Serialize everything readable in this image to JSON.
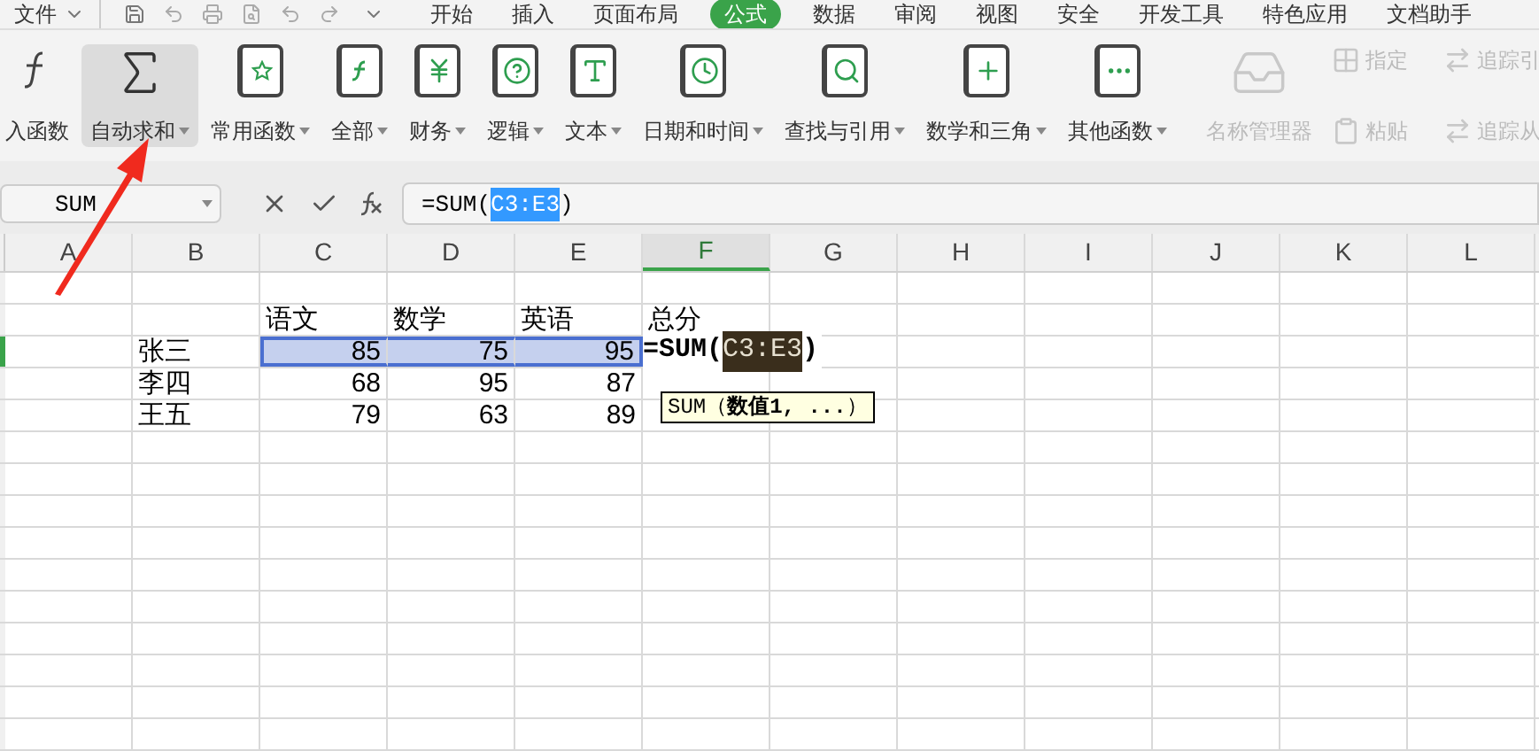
{
  "menu_tabs": [
    {
      "label": "文件",
      "selected": false
    },
    {
      "label": "开始",
      "selected": false
    },
    {
      "label": "插入",
      "selected": false
    },
    {
      "label": "页面布局",
      "selected": false
    },
    {
      "label": "公式",
      "selected": true
    },
    {
      "label": "数据",
      "selected": false
    },
    {
      "label": "审阅",
      "selected": false
    },
    {
      "label": "视图",
      "selected": false
    },
    {
      "label": "安全",
      "selected": false
    },
    {
      "label": "开发工具",
      "selected": false
    },
    {
      "label": "特色应用",
      "selected": false
    },
    {
      "label": "文档助手",
      "selected": false
    }
  ],
  "ribbon": [
    {
      "kind": "large",
      "label": "入函数",
      "dropdown": false,
      "selected": false,
      "disabled": false
    },
    {
      "kind": "large",
      "label": "自动求和",
      "dropdown": true,
      "selected": true,
      "disabled": false
    },
    {
      "kind": "large",
      "label": "常用函数",
      "dropdown": true,
      "selected": false,
      "disabled": false
    },
    {
      "kind": "large",
      "label": "全部",
      "dropdown": true,
      "selected": false,
      "disabled": false
    },
    {
      "kind": "large",
      "label": "财务",
      "dropdown": true,
      "selected": false,
      "disabled": false
    },
    {
      "kind": "large",
      "label": "逻辑",
      "dropdown": true,
      "selected": false,
      "disabled": false
    },
    {
      "kind": "large",
      "label": "文本",
      "dropdown": true,
      "selected": false,
      "disabled": false
    },
    {
      "kind": "large",
      "label": "日期和时间",
      "dropdown": true,
      "selected": false,
      "disabled": false
    },
    {
      "kind": "large",
      "label": "查找与引用",
      "dropdown": true,
      "selected": false,
      "disabled": false
    },
    {
      "kind": "large",
      "label": "数学和三角",
      "dropdown": true,
      "selected": false,
      "disabled": false
    },
    {
      "kind": "large",
      "label": "其他函数",
      "dropdown": true,
      "selected": false,
      "disabled": false
    },
    {
      "kind": "divider"
    },
    {
      "kind": "large",
      "label": "名称管理器",
      "dropdown": false,
      "selected": false,
      "disabled": true
    },
    {
      "kind": "stack",
      "items": [
        {
          "label": "指定",
          "disabled": true
        },
        {
          "label": "粘贴",
          "disabled": true
        }
      ]
    },
    {
      "kind": "divider"
    },
    {
      "kind": "stack",
      "items": [
        {
          "label": "追踪引",
          "disabled": true
        },
        {
          "label": "追踪从",
          "disabled": true
        }
      ]
    }
  ],
  "formula_bar": {
    "name_box": "SUM",
    "formula_before": "=SUM(",
    "formula_ref": "C3:E3",
    "formula_after": ")"
  },
  "columns": [
    {
      "label": "A",
      "selected": false
    },
    {
      "label": "B",
      "selected": false
    },
    {
      "label": "C",
      "selected": false
    },
    {
      "label": "D",
      "selected": false
    },
    {
      "label": "E",
      "selected": false
    },
    {
      "label": "F",
      "selected": true
    },
    {
      "label": "G",
      "selected": false
    },
    {
      "label": "H",
      "selected": false
    },
    {
      "label": "I",
      "selected": false
    },
    {
      "label": "J",
      "selected": false
    },
    {
      "label": "K",
      "selected": false
    },
    {
      "label": "L",
      "selected": false
    }
  ],
  "rows": [
    {
      "active": false,
      "cells": []
    },
    {
      "active": false,
      "cells": [
        {
          "kind": "empty",
          "selected": false
        },
        {
          "kind": "empty",
          "selected": false
        },
        {
          "kind": "text",
          "text": "语文",
          "selected": false
        },
        {
          "kind": "text",
          "text": "数学",
          "selected": false
        },
        {
          "kind": "text",
          "text": "英语",
          "selected": false
        },
        {
          "kind": "text",
          "text": "总分",
          "selected": false
        }
      ]
    },
    {
      "active": true,
      "cells": [
        {
          "kind": "empty",
          "selected": false
        },
        {
          "kind": "text",
          "text": "张三",
          "selected": false
        },
        {
          "kind": "number",
          "text": "85",
          "selected": true
        },
        {
          "kind": "number",
          "text": "75",
          "selected": true
        },
        {
          "kind": "number",
          "text": "95",
          "selected": true
        },
        {
          "kind": "editing",
          "before": "=SUM(",
          "ref": "C3:E3",
          "after": ")",
          "selected": false
        }
      ]
    },
    {
      "active": false,
      "cells": [
        {
          "kind": "empty",
          "selected": false
        },
        {
          "kind": "text",
          "text": "李四",
          "selected": false
        },
        {
          "kind": "number",
          "text": "68",
          "selected": false
        },
        {
          "kind": "number",
          "text": "95",
          "selected": false
        },
        {
          "kind": "number",
          "text": "87",
          "selected": false
        }
      ]
    },
    {
      "active": false,
      "cells": [
        {
          "kind": "empty",
          "selected": false
        },
        {
          "kind": "text",
          "text": "王五",
          "selected": false
        },
        {
          "kind": "number",
          "text": "79",
          "selected": false
        },
        {
          "kind": "number",
          "text": "63",
          "selected": false
        },
        {
          "kind": "number",
          "text": "89",
          "selected": false
        }
      ]
    }
  ],
  "tooltip": {
    "text": "SUM（**数值1, ...**）"
  }
}
